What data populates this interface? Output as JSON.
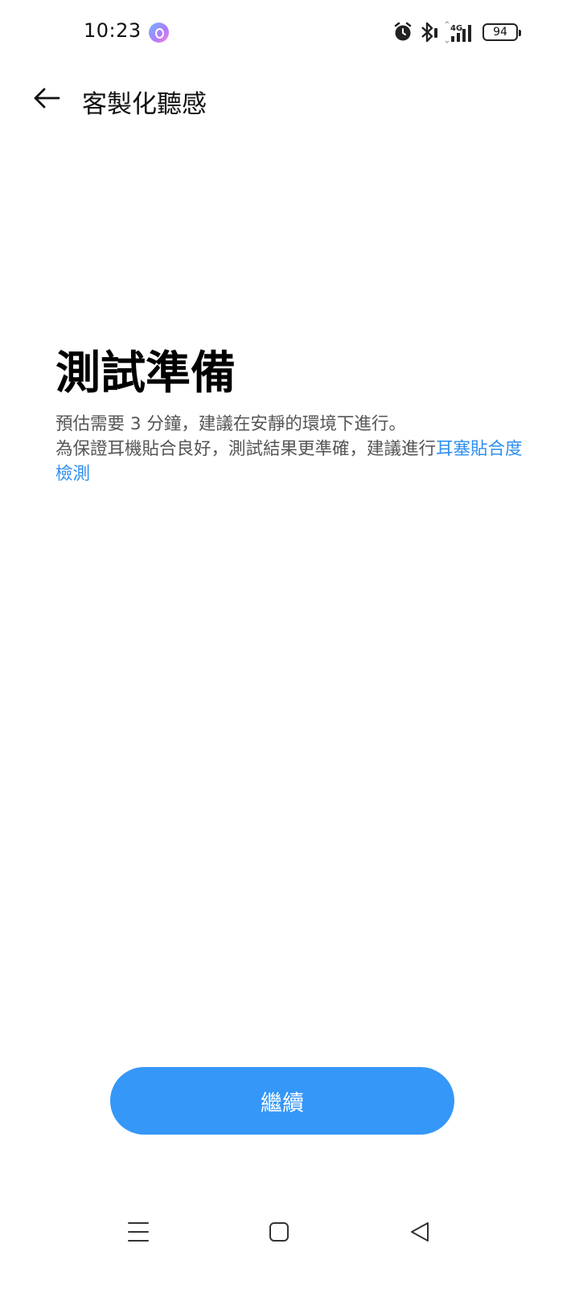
{
  "status_bar": {
    "time": "10:23",
    "network": "4G",
    "battery": "94",
    "icons": [
      "app-indicator-icon",
      "alarm-icon",
      "bluetooth-icon",
      "signal-icon",
      "battery-icon"
    ]
  },
  "app_bar": {
    "back_icon": "arrow-left-icon",
    "title": "客製化聽感"
  },
  "content": {
    "heading": "測試準備",
    "line1": "預估需要 3 分鐘，建議在安靜的環境下進行。",
    "line2_prefix": "為保證耳機貼合良好，測試結果更準確，建議進行",
    "line2_link": "耳塞貼合度檢測"
  },
  "actions": {
    "continue_label": "繼續"
  },
  "colors": {
    "accent": "#3597f7",
    "link": "#2e8ff0",
    "text_secondary": "#555555"
  },
  "nav_bar": {
    "icons": [
      "menu-icon",
      "home-icon",
      "back-triangle-icon"
    ]
  }
}
